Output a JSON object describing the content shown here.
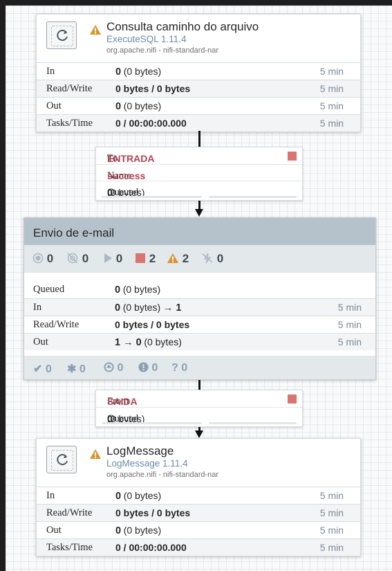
{
  "colors": {
    "canvas": "#f9fafb",
    "group_header": "#b5c2cb",
    "group_stats": "#e3e8eb",
    "warning": "#d9922e",
    "stopped": "#d97471",
    "relationship": "#b04454",
    "time_text": "#7b8a96",
    "type_text": "#6b8bab"
  },
  "processor1": {
    "icon": "processor-icon",
    "warning_icon": "warning-icon",
    "name": "Consulta caminho do arquivo",
    "type": "ExecuteSQL 1.11.4",
    "bundle": "org.apache.nifi - nifi-standard-nar",
    "stats": {
      "in_label": "In",
      "in_count": "0",
      "in_bytes": "(0 bytes)",
      "in_time": "5 min",
      "rw_label": "Read/Write",
      "rw_value": "0 bytes / 0 bytes",
      "rw_time": "5 min",
      "out_label": "Out",
      "out_count": "0",
      "out_bytes": "(0 bytes)",
      "out_time": "5 min",
      "tasks_label": "Tasks/Time",
      "tasks_value": "0 / 00:00:00.000",
      "tasks_time": "5 min"
    }
  },
  "connection1": {
    "to_label": "To",
    "to_port": "ENTRADA",
    "name_label": "Name",
    "name_value": "success",
    "queued_label": "Queued",
    "queued_count": "0",
    "queued_bytes": "(0 bytes)"
  },
  "group": {
    "title": "Envio de e-mail",
    "stats": {
      "transmitting": "0",
      "not_transmitting": "0",
      "running": "0",
      "stopped": "2",
      "invalid": "2",
      "disabled": "0"
    },
    "rows": {
      "queued_label": "Queued",
      "queued_count": "0",
      "queued_bytes": "(0 bytes)",
      "in_label": "In",
      "in_count": "0",
      "in_bytes": "(0 bytes)",
      "in_arrow": "→ 1",
      "in_time": "5 min",
      "rw_label": "Read/Write",
      "rw_value": "0 bytes / 0 bytes",
      "rw_time": "5 min",
      "out_label": "Out",
      "out_value": "1 → 0",
      "out_bytes": "(0 bytes)",
      "out_time": "5 min"
    },
    "footer": {
      "up_to_date": "0",
      "locally_modified": "0",
      "stale": "0",
      "modified_stale": "0",
      "sync_failure": "0"
    }
  },
  "connection2": {
    "from_label": "From",
    "from_port": "SAIDA",
    "queued_label": "Queued",
    "queued_count": "0",
    "queued_bytes": "(0 bytes)"
  },
  "processor2": {
    "icon": "processor-icon",
    "warning_icon": "warning-icon",
    "name": "LogMessage",
    "type": "LogMessage 1.11.4",
    "bundle": "org.apache.nifi - nifi-standard-nar",
    "stats": {
      "in_label": "In",
      "in_count": "0",
      "in_bytes": "(0 bytes)",
      "in_time": "5 min",
      "rw_label": "Read/Write",
      "rw_value": "0 bytes / 0 bytes",
      "rw_time": "5 min",
      "out_label": "Out",
      "out_count": "0",
      "out_bytes": "(0 bytes)",
      "out_time": "5 min",
      "tasks_label": "Tasks/Time",
      "tasks_value": "0 / 00:00:00.000",
      "tasks_time": "5 min"
    }
  }
}
